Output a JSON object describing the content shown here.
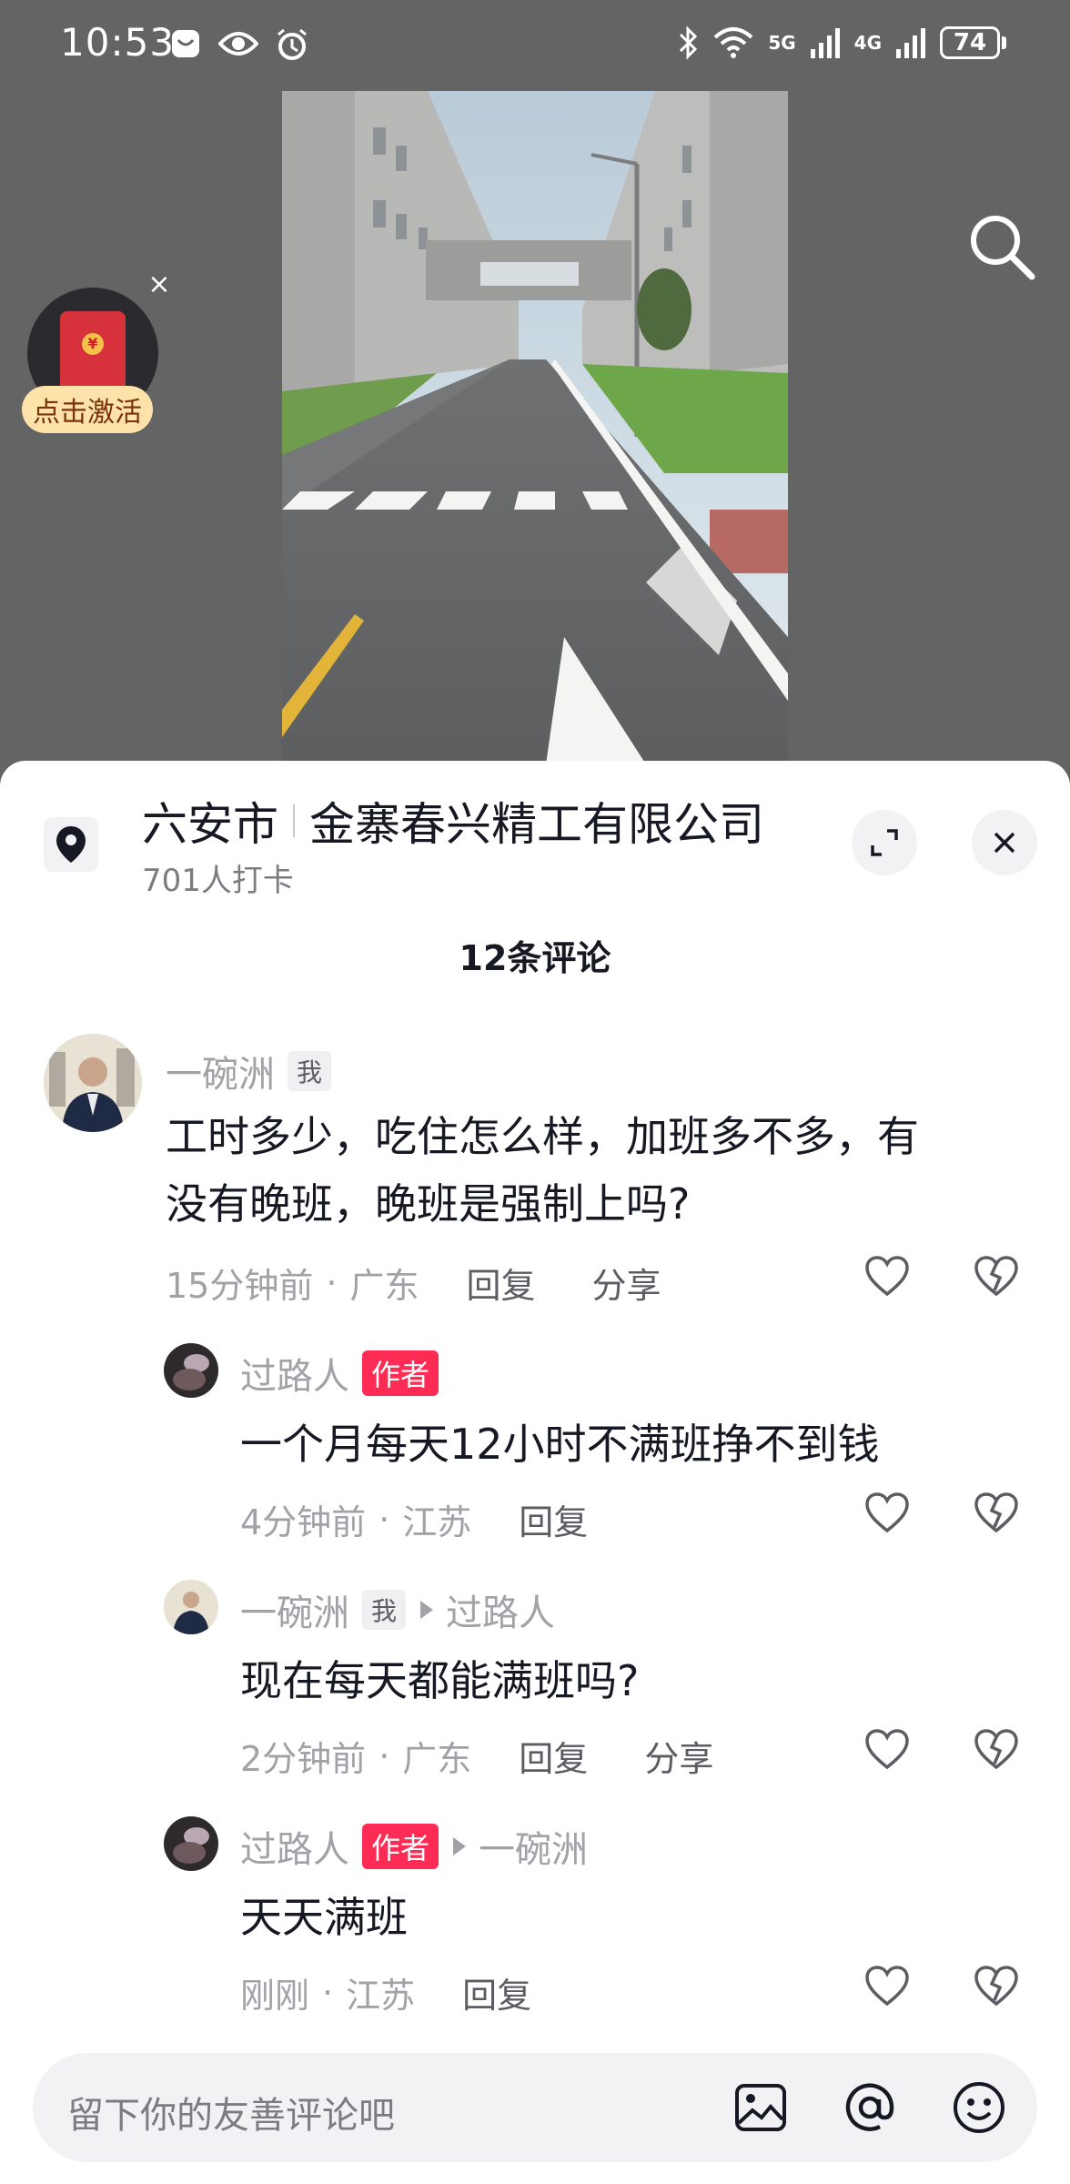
{
  "status_bar": {
    "time": "10:53",
    "net_5g": "5G",
    "net_4g": "4G",
    "battery": "74"
  },
  "redpack": {
    "label": "点击激活",
    "coin": "¥",
    "close": "×"
  },
  "location": {
    "city": "六安市",
    "place": "金寨春兴精工有限公司",
    "checkins": "701人打卡"
  },
  "comments_header": "12条评论",
  "comments": [
    {
      "name": "一碗洲",
      "tag": "我",
      "text_lines": [
        "工时多少，吃住怎么样，加班多不多，有",
        "没有晚班，晚班是强制上吗?"
      ],
      "time": "15分钟前",
      "region": "广东",
      "reply": "回复",
      "share": "分享"
    },
    {
      "name": "过路人",
      "tag": "作者",
      "text": "一个月每天12小时不满班挣不到钱",
      "time": "4分钟前",
      "region": "江苏",
      "reply": "回复"
    },
    {
      "name": "一碗洲",
      "tag": "我",
      "reply_to": "过路人",
      "text": "现在每天都能满班吗?",
      "time": "2分钟前",
      "region": "广东",
      "reply": "回复",
      "share": "分享"
    },
    {
      "name": "过路人",
      "tag": "作者",
      "reply_to": "一碗洲",
      "text": "天天满班",
      "time": "刚刚",
      "region": "江苏",
      "reply": "回复"
    }
  ],
  "input": {
    "placeholder": "留下你的友善评论吧"
  },
  "colors": {
    "accent": "#fe2c55",
    "sheet_bg": "#ffffff",
    "muted_text": "#a1a2a7"
  }
}
